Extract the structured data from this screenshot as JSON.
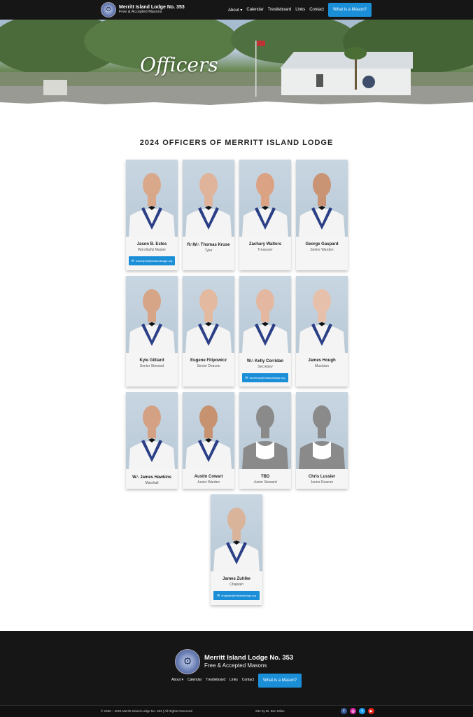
{
  "header": {
    "brand_name": "Merritt Island Lodge No. 353",
    "brand_sub": "Free & Accepted Masons",
    "nav": [
      "About ▾",
      "Calendar",
      "Trestleboard",
      "Links",
      "Contact"
    ],
    "cta": "What is a Mason?"
  },
  "hero": {
    "title": "Officers"
  },
  "section": {
    "title": "2024 OFFICERS OF MERRITT ISLAND LODGE"
  },
  "officers": [
    {
      "name": "Jason B. Estes",
      "role": "Worshipful Master",
      "email": "worshipful@mislandlodge.org"
    },
    {
      "name": "R∴W∴ Thomas Kruse",
      "role": "Tyler"
    },
    {
      "name": "Zachary Walters",
      "role": "Treasurer"
    },
    {
      "name": "George Gaspard",
      "role": "Senior Warden"
    },
    {
      "name": "Kyle Gilliard",
      "role": "Senior Steward"
    },
    {
      "name": "Eugene Filipowicz",
      "role": "Senior Deacon"
    },
    {
      "name": "W∴ Kelly Corridan",
      "role": "Secretary",
      "email": "secretary@mislandlodge.org"
    },
    {
      "name": "James Hough",
      "role": "Musician"
    },
    {
      "name": "W∴ James Hawkins",
      "role": "Marshall"
    },
    {
      "name": "Austin Cowart",
      "role": "Junior Warden"
    },
    {
      "name": "TBD",
      "role": "Junior Steward"
    },
    {
      "name": "Chris Lussier",
      "role": "Junior Deacon"
    },
    {
      "name": "James Zuhlke",
      "role": "Chaplain",
      "email": "chaplain@mislandlodge.org"
    }
  ],
  "footer": {
    "name": "Merritt Island Lodge No. 353",
    "sub": "Free & Accepted Masons",
    "nav": [
      "About ▾",
      "Calendar",
      "Trestleboard",
      "Links",
      "Contact"
    ],
    "cta": "What is a Mason?",
    "copyright": "© 1966 – 2024 Merritt Island Lodge No. 353 | All Rights Reserved.",
    "credit": "Site by Br. Ben Miles",
    "socials": [
      {
        "icon": "facebook-icon",
        "glyph": "f",
        "color": "#3b5998"
      },
      {
        "icon": "instagram-icon",
        "glyph": "◎",
        "color": "#d6249f"
      },
      {
        "icon": "twitter-icon",
        "glyph": "t",
        "color": "#1da1f2"
      },
      {
        "icon": "youtube-icon",
        "glyph": "▶",
        "color": "#e62117"
      }
    ]
  },
  "colors": {
    "accent": "#1a8fd8",
    "dark": "#161616"
  }
}
